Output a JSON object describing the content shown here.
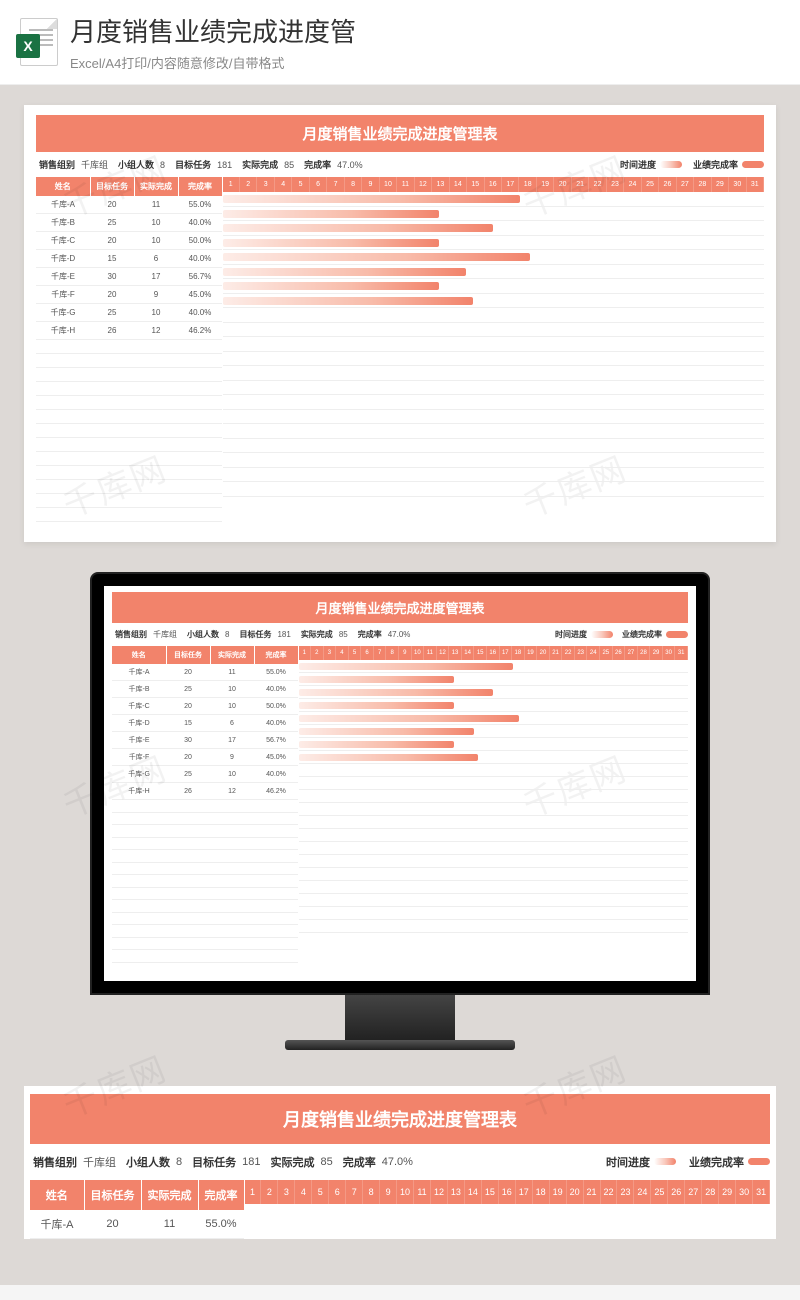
{
  "header": {
    "title": "月度销售业绩完成进度管",
    "subtitle": "Excel/A4打印/内容随意修改/自带格式",
    "icon_letter": "X"
  },
  "sheet": {
    "title": "月度销售业绩完成进度管理表",
    "summary": {
      "team_label": "销售组别",
      "team_value": "千库组",
      "count_label": "小组人数",
      "count_value": "8",
      "target_label": "目标任务",
      "target_value": "181",
      "actual_label": "实际完成",
      "actual_value": "85",
      "rate_label": "完成率",
      "rate_value": "47.0%",
      "legend_time": "时间进度",
      "legend_rate": "业绩完成率"
    },
    "columns": {
      "name": "姓名",
      "target": "目标任务",
      "actual": "实际完成",
      "rate": "完成率"
    },
    "days": [
      "1",
      "2",
      "3",
      "4",
      "5",
      "6",
      "7",
      "8",
      "9",
      "10",
      "11",
      "12",
      "13",
      "14",
      "15",
      "16",
      "17",
      "18",
      "19",
      "20",
      "21",
      "22",
      "23",
      "24",
      "25",
      "26",
      "27",
      "28",
      "29",
      "30",
      "31"
    ],
    "empty_rows": 13
  },
  "chart_data": {
    "type": "bar",
    "title": "月度销售业绩完成进度管理表",
    "xlabel": "完成率",
    "ylabel": "姓名",
    "categories": [
      "千库-A",
      "千库-B",
      "千库-C",
      "千库-D",
      "千库-E",
      "千库-F",
      "千库-G",
      "千库-H"
    ],
    "series": [
      {
        "name": "目标任务",
        "values": [
          20,
          25,
          20,
          15,
          30,
          20,
          25,
          26
        ]
      },
      {
        "name": "实际完成",
        "values": [
          11,
          10,
          10,
          6,
          17,
          9,
          10,
          12
        ]
      },
      {
        "name": "完成率(%)",
        "values": [
          55.0,
          40.0,
          50.0,
          40.0,
          56.7,
          45.0,
          40.0,
          46.2
        ]
      }
    ],
    "rate_labels": [
      "55.0%",
      "40.0%",
      "50.0%",
      "40.0%",
      "56.7%",
      "45.0%",
      "40.0%",
      "46.2%"
    ],
    "xlim_days": [
      1,
      31
    ]
  },
  "watermark": "千库网"
}
